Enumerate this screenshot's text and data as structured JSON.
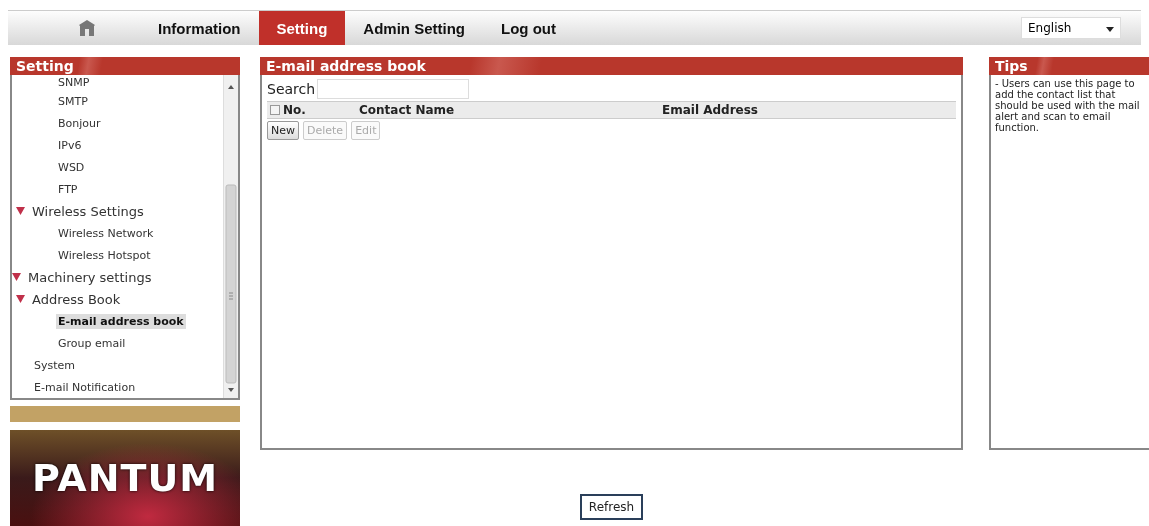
{
  "top_nav": {
    "tabs": [
      {
        "label": "Information",
        "selected": false
      },
      {
        "label": "Setting",
        "selected": true
      },
      {
        "label": "Admin Setting",
        "selected": false
      },
      {
        "label": "Log out",
        "selected": false
      }
    ],
    "language": "English"
  },
  "sidebar": {
    "title": "Setting",
    "items": [
      {
        "children": [
          {
            "children": [
              {
                "label": "SNMP",
                "selected": false
              },
              {
                "label": "SMTP",
                "selected": false
              },
              {
                "label": "Bonjour",
                "selected": false
              },
              {
                "label": "IPv6",
                "selected": false
              },
              {
                "label": "WSD",
                "selected": false
              },
              {
                "label": "FTP",
                "selected": false
              }
            ]
          },
          {
            "label": "Wireless Settings",
            "expanded": true,
            "children": [
              {
                "label": "Wireless Network",
                "selected": false
              },
              {
                "label": "Wireless Hotspot",
                "selected": false
              }
            ]
          }
        ]
      },
      {
        "label": "Machinery settings",
        "expanded": true,
        "children": [
          {
            "label": "Address Book",
            "expanded": true,
            "children": [
              {
                "label": "E-mail address book",
                "selected": true
              },
              {
                "label": "Group email",
                "selected": false
              }
            ]
          },
          {
            "label": "System",
            "selected": false
          },
          {
            "label": "E-mail Notification",
            "selected": false
          }
        ]
      }
    ]
  },
  "logo": {
    "text": "PANTUM"
  },
  "main": {
    "title": "E-mail address book",
    "search_label": "Search",
    "select_all": {
      "checked": false
    },
    "columns": [
      "No.",
      "Contact Name",
      "Email Address"
    ],
    "buttons": [
      {
        "label": "New",
        "disabled": false
      },
      {
        "label": "Delete",
        "disabled": true
      },
      {
        "label": "Edit",
        "disabled": true
      }
    ]
  },
  "tips": {
    "title": "Tips",
    "text": "- Users can use this page to add the contact list that should be used with the mail alert and scan to email function."
  },
  "footer": {
    "button": "Refresh"
  }
}
